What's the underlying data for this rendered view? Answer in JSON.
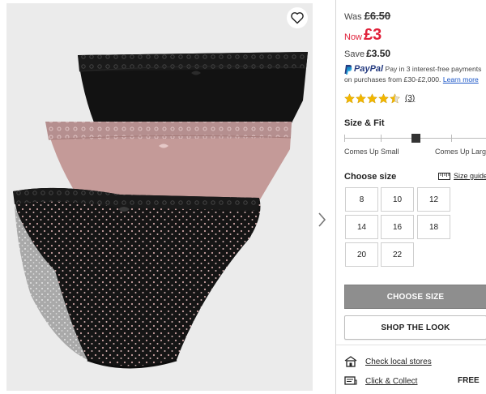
{
  "gallery": {
    "wishlist_icon": "heart-icon",
    "next_icon": "chevron-right-icon"
  },
  "price": {
    "was_label": "Was",
    "was_value": "£6.50",
    "now_label": "Now",
    "now_value": "£3",
    "save_label": "Save",
    "save_value": "£3.50",
    "sale_color": "#e0213a"
  },
  "paypal": {
    "brand": "PayPal",
    "line1": "Pay in 3 interest-free payments",
    "line2": "on purchases from £30-£2,000.",
    "learn_more": "Learn more"
  },
  "rating": {
    "stars": 4.5,
    "max": 5,
    "count_text": "(3)",
    "star_color": "#f2b600"
  },
  "size_fit": {
    "title": "Size & Fit",
    "left_label": "Comes Up Small",
    "right_label": "Comes Up Large",
    "value": 0.5
  },
  "choose_size": {
    "title": "Choose size",
    "guide_label": "Size guide",
    "sizes": [
      "8",
      "10",
      "12",
      "14",
      "16",
      "18",
      "20",
      "22"
    ]
  },
  "actions": {
    "choose_size_button": "CHOOSE SIZE",
    "shop_look_button": "SHOP THE LOOK"
  },
  "delivery": {
    "local_stores": "Check local stores",
    "click_collect": "Click & Collect",
    "click_collect_price": "FREE"
  }
}
